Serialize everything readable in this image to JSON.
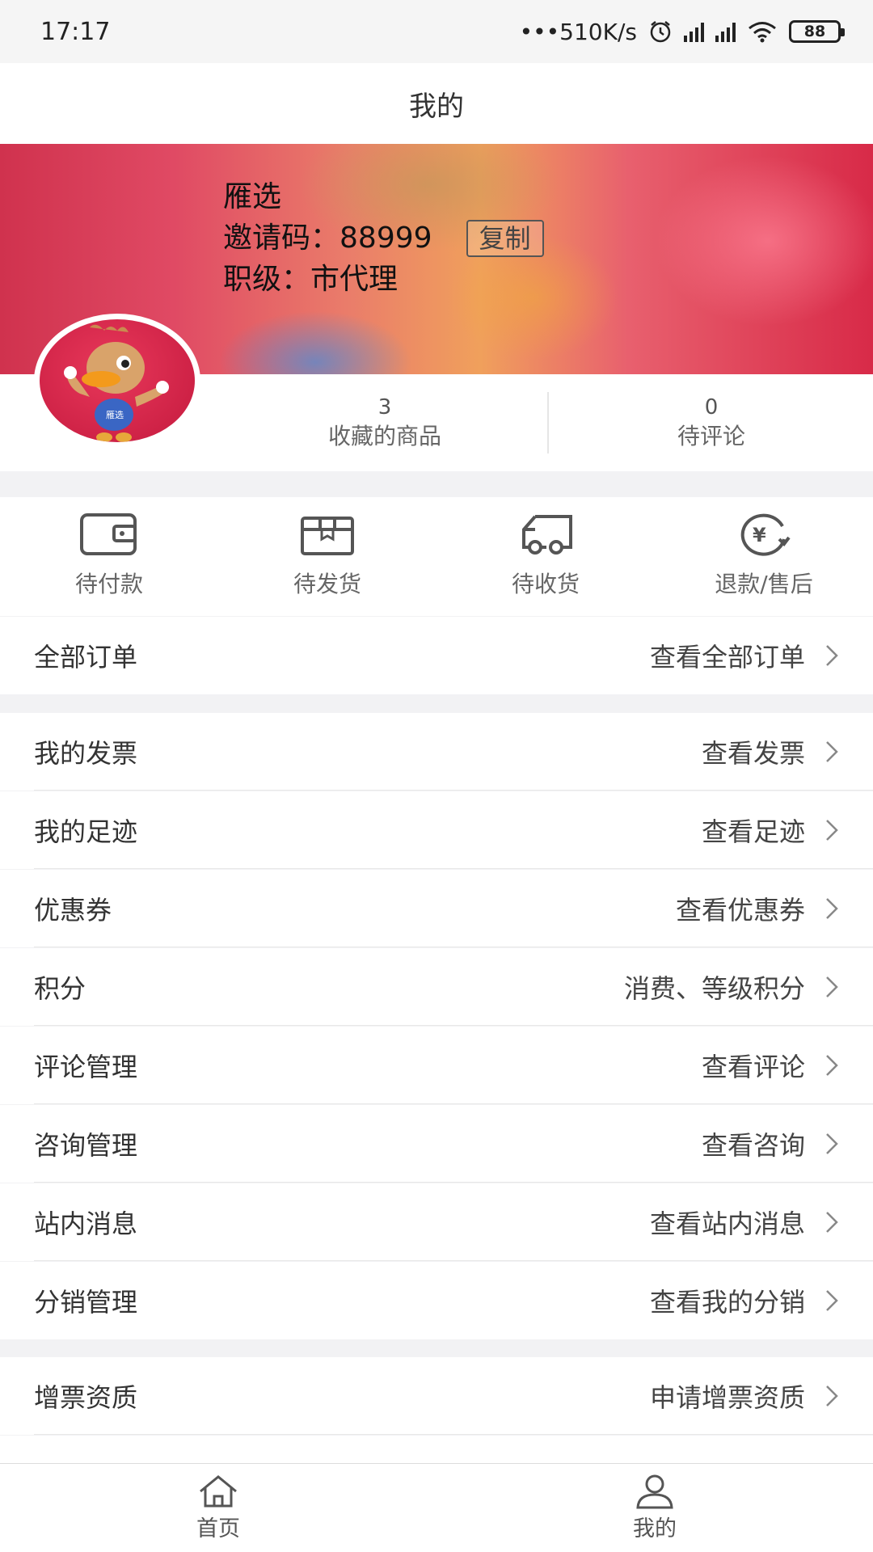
{
  "status": {
    "time": "17:17",
    "speed": "•••510K/s",
    "battery": "88"
  },
  "header": {
    "title": "我的"
  },
  "profile": {
    "name": "雁选",
    "invite_label": "邀请码：",
    "invite_code": "88999",
    "copy_label": "复制",
    "level_label": "职级：",
    "level_value": "市代理",
    "avatar_icon": "duck-mascot-avatar"
  },
  "stats": [
    {
      "num": "3",
      "label": "收藏的商品"
    },
    {
      "num": "0",
      "label": "待评论"
    }
  ],
  "order_shortcuts": [
    {
      "label": "待付款",
      "icon": "wallet-icon"
    },
    {
      "label": "待发货",
      "icon": "box-icon"
    },
    {
      "label": "待收货",
      "icon": "truck-icon"
    },
    {
      "label": "退款/售后",
      "icon": "refund-icon"
    }
  ],
  "all_orders": {
    "label": "全部订单",
    "action": "查看全部订单"
  },
  "menu": [
    {
      "label": "我的发票",
      "action": "查看发票"
    },
    {
      "label": "我的足迹",
      "action": "查看足迹"
    },
    {
      "label": "优惠券",
      "action": "查看优惠券"
    },
    {
      "label": "积分",
      "action": "消费、等级积分"
    },
    {
      "label": "评论管理",
      "action": "查看评论"
    },
    {
      "label": "咨询管理",
      "action": "查看咨询"
    },
    {
      "label": "站内消息",
      "action": "查看站内消息"
    },
    {
      "label": "分销管理",
      "action": "查看我的分销"
    }
  ],
  "invoice_qual": {
    "label": "增票资质",
    "action": "申请增票资质"
  },
  "tabs": [
    {
      "label": "首页",
      "icon": "home-icon"
    },
    {
      "label": "我的",
      "icon": "user-icon"
    }
  ]
}
